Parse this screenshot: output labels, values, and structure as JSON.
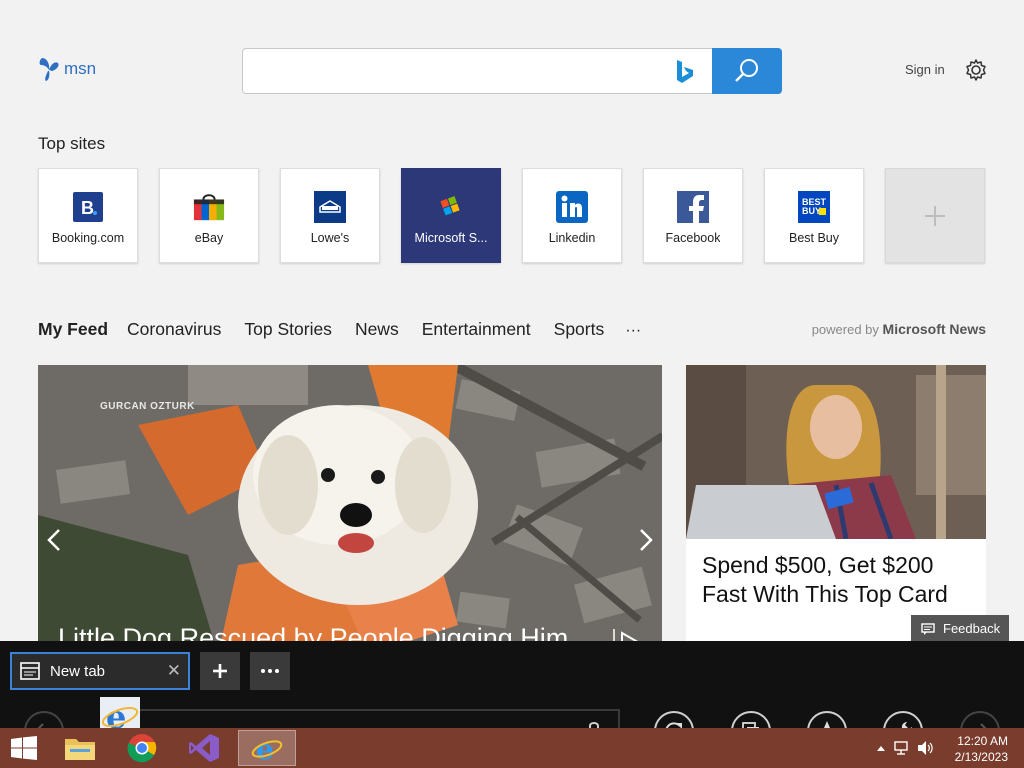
{
  "header": {
    "logo_text": "msn",
    "search_placeholder": "",
    "signin_label": "Sign in"
  },
  "top_sites": {
    "title": "Top sites",
    "tiles": [
      {
        "label": "Booking.com",
        "icon": "booking-icon"
      },
      {
        "label": "eBay",
        "icon": "ebay-bag-icon"
      },
      {
        "label": "Lowe's",
        "icon": "lowes-icon"
      },
      {
        "label": "Microsoft S...",
        "icon": "microsoft-store-icon"
      },
      {
        "label": "Linkedin",
        "icon": "linkedin-icon"
      },
      {
        "label": "Facebook",
        "icon": "facebook-icon"
      },
      {
        "label": "Best Buy",
        "icon": "bestbuy-icon"
      }
    ]
  },
  "feed_nav": {
    "items": [
      "My Feed",
      "Coronavirus",
      "Top Stories",
      "News",
      "Entertainment",
      "Sports"
    ],
    "more": "···",
    "powered_by_prefix": "powered by",
    "powered_by_brand": "Microsoft News"
  },
  "hero": {
    "credit": "GURCAN OZTURK",
    "headline": "Little Dog Rescued by People Digging Him"
  },
  "ad": {
    "title": "Spend $500, Get $200 Fast With This Top Card"
  },
  "feedback_label": "Feedback",
  "browser": {
    "tab_label": "New tab"
  },
  "clock": {
    "time": "12:20 AM",
    "date": "2/13/2023"
  },
  "colors": {
    "accent": "#2b88d8",
    "selected_tile": "#2d3879",
    "taskbar": "#7a3d2d"
  }
}
